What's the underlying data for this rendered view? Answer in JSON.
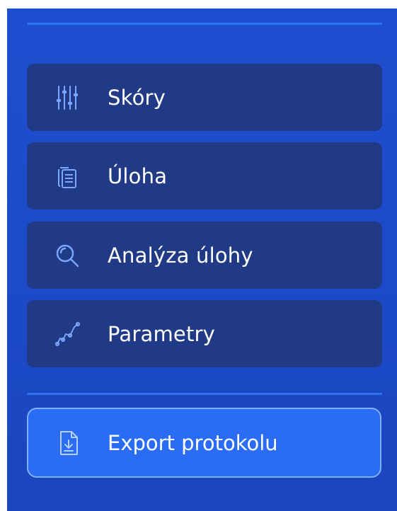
{
  "nav": {
    "items": [
      {
        "label": "Skóry",
        "icon": "sliders-icon"
      },
      {
        "label": "Úloha",
        "icon": "documents-icon"
      },
      {
        "label": "Analýza úlohy",
        "icon": "magnifier-icon"
      },
      {
        "label": "Parametry",
        "icon": "line-graph-icon"
      }
    ]
  },
  "export": {
    "label": "Export protokolu",
    "icon": "file-download-icon"
  },
  "colors": {
    "panel_background": "#1e4fd0",
    "item_background": "#203a85",
    "divider": "#2d72f5",
    "icon_color": "#7aa8ff",
    "export_background": "#2a6df4",
    "export_border": "#7fb0ff",
    "text": "#ffffff"
  }
}
